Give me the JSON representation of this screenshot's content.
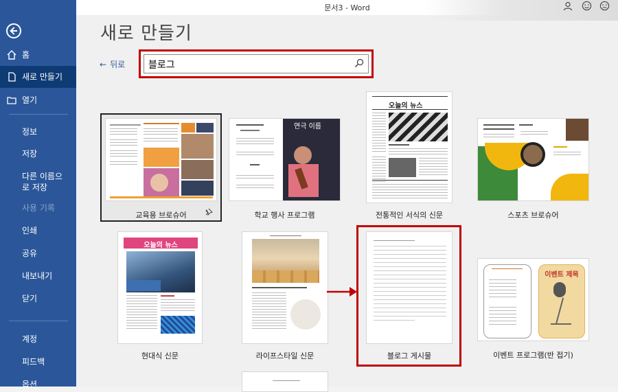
{
  "window": {
    "title": "문서3  -  Word"
  },
  "sidebar": {
    "items": [
      {
        "label": "홈"
      },
      {
        "label": "새로 만들기"
      },
      {
        "label": "열기"
      },
      {
        "label": "정보"
      },
      {
        "label": "저장"
      },
      {
        "label": "다른 이름으로 저장"
      },
      {
        "label": "사용 기록"
      },
      {
        "label": "인쇄"
      },
      {
        "label": "공유"
      },
      {
        "label": "내보내기"
      },
      {
        "label": "닫기"
      },
      {
        "label": "계정"
      },
      {
        "label": "피드백"
      },
      {
        "label": "옵션"
      }
    ]
  },
  "header": {
    "title": "새로 만들기",
    "back_label": "뒤로"
  },
  "search": {
    "value": "블로그"
  },
  "templates": [
    {
      "label": "교육용 브로슈어"
    },
    {
      "label": "학교 행사 프로그램"
    },
    {
      "label": "전통적인 서식의 신문"
    },
    {
      "label": "스포츠 브로슈어"
    },
    {
      "label": "현대식 신문"
    },
    {
      "label": "라이프스타일 신문"
    },
    {
      "label": "블로그 게시물"
    },
    {
      "label": "이벤트 프로그램(반 접기)"
    }
  ],
  "thumb_text": {
    "news_title": "오늘의 뉴스",
    "modern_news_title": "오늘의 뉴스",
    "event_title": "이벤트 제목",
    "school_title": "연극 이름"
  },
  "colors": {
    "sidebar": "#2b579a",
    "highlight": "#c00000"
  }
}
